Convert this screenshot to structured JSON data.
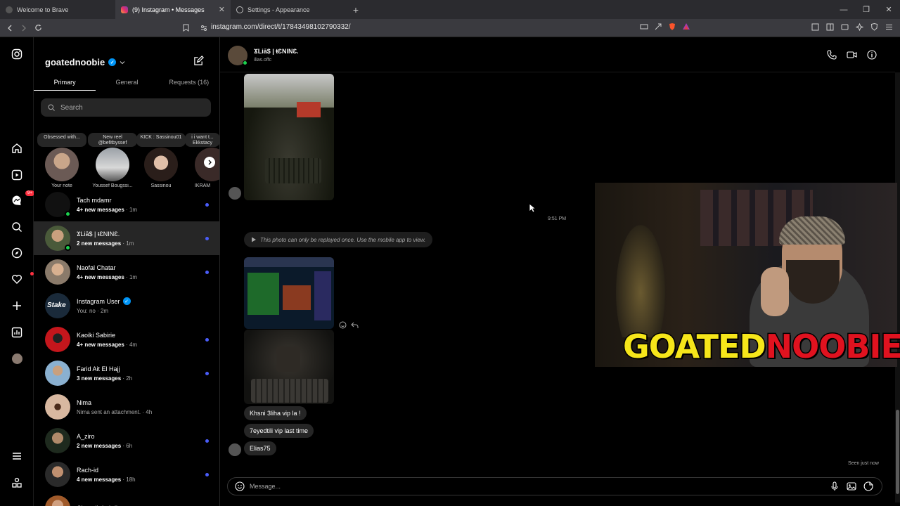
{
  "browser": {
    "tabs": [
      {
        "title": "Welcome to Brave",
        "active": false,
        "close": ""
      },
      {
        "title": "(9) Instagram • Messages",
        "active": true,
        "close": "✕"
      },
      {
        "title": "Settings - Appearance",
        "active": false,
        "close": ""
      }
    ],
    "new_tab": "+",
    "url": "instagram.com/direct/t/17843498102790332/",
    "window_controls": [
      "—",
      "❐",
      "✕"
    ]
  },
  "rail": {
    "notifications_badge": "9+"
  },
  "inbox": {
    "username": "goatednoobie",
    "tabs": [
      {
        "label": "Primary",
        "active": true
      },
      {
        "label": "General",
        "active": false
      },
      {
        "label": "Requests (16)",
        "active": false
      }
    ],
    "search_placeholder": "Search",
    "notes": [
      {
        "bubble": "Obsessed with...",
        "name": "Your note"
      },
      {
        "bubble": "New reel @befitbyssef",
        "name": "Youssef Bougssi..."
      },
      {
        "bubble": "KICK : Sassinou01",
        "name": "Sassinou"
      },
      {
        "bubble": "i i want t... Ekkstacy",
        "name": "IKRAM"
      }
    ],
    "conversations": [
      {
        "name": "Tach mdamr",
        "preview": "4+ new messages",
        "time": "· 1m",
        "unread": true,
        "online": true,
        "bold": true
      },
      {
        "name": "ϪLiā$ | ŧƐNINƐ.",
        "preview": "2 new messages",
        "time": "· 1m",
        "unread": true,
        "online": true,
        "bold": true
      },
      {
        "name": "Naofal Chatar",
        "preview": "4+ new messages",
        "time": "· 1m",
        "unread": true,
        "online": false,
        "bold": true
      },
      {
        "name": "Instagram User",
        "preview": "You: no",
        "time": "· 2m",
        "unread": false,
        "online": false,
        "bold": false
      },
      {
        "name": "Kaoiki Sabirie",
        "preview": "4+ new messages",
        "time": "· 4m",
        "unread": true,
        "online": false,
        "bold": true
      },
      {
        "name": "Farid Ait El Hajj",
        "preview": "3 new messages",
        "time": "· 2h",
        "unread": true,
        "online": false,
        "bold": true
      },
      {
        "name": "Nima",
        "preview": "Nima sent an attachment.",
        "time": "· 4h",
        "unread": false,
        "online": false,
        "bold": false
      },
      {
        "name": "A_ziro",
        "preview": "2 new messages",
        "time": "· 6h",
        "unread": true,
        "online": false,
        "bold": true
      },
      {
        "name": "Rach-id",
        "preview": "4 new messages",
        "time": "· 18h",
        "unread": true,
        "online": false,
        "bold": true
      },
      {
        "name": "Chouaib Labdi",
        "preview": "",
        "time": "",
        "unread": false,
        "online": false,
        "bold": true
      }
    ]
  },
  "chat": {
    "header_title": "ϪLiā$ | ŧƐNINƐ.",
    "header_subtitle": "ilias.offc",
    "timestamp": "9:51 PM",
    "vanish_notice": "This photo can only be replayed once. Use the mobile app to view.",
    "messages": [
      "Khsni 3liha vip la !",
      "7eyedtili vip last time",
      "Elias75"
    ],
    "seen": "Seen just now",
    "composer_placeholder": "Message..."
  },
  "overlay": {
    "logo_part1": "GOATED",
    "logo_part2": "NOOBIE",
    "color1": "#f6e61a",
    "color2": "#e0121f"
  }
}
